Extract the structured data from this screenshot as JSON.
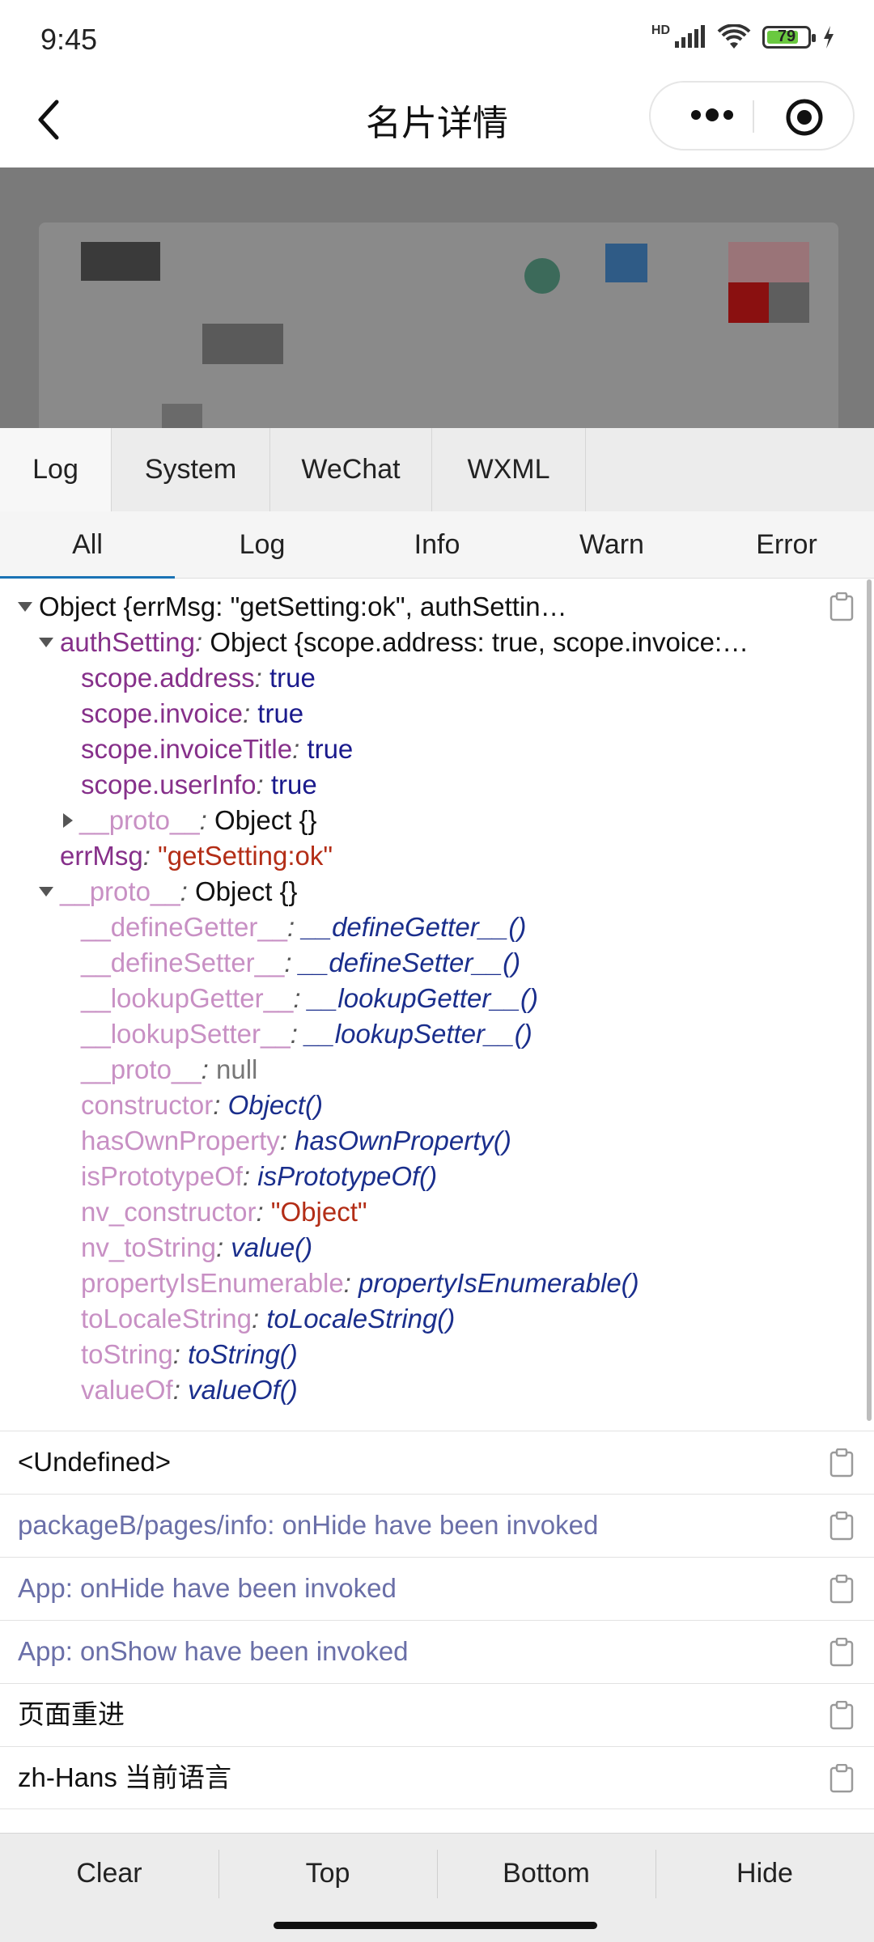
{
  "status_bar": {
    "time": "9:45",
    "battery": "79",
    "network": "HD"
  },
  "nav": {
    "title": "名片详情",
    "back_icon": "chevron-left-icon",
    "more_icon": "more-dots-icon",
    "record_icon": "record-icon"
  },
  "tabs": [
    "Log",
    "System",
    "WeChat",
    "WXML"
  ],
  "subtabs": [
    "All",
    "Log",
    "Info",
    "Warn",
    "Error"
  ],
  "tree": {
    "root": "Object {errMsg: \"getSetting:ok\", authSettin…",
    "auth_key": "authSetting",
    "auth_val": "Object {scope.address: true, scope.invoice:…",
    "auth_items": [
      {
        "key": "scope.address",
        "val": "true"
      },
      {
        "key": "scope.invoice",
        "val": "true"
      },
      {
        "key": "scope.invoiceTitle",
        "val": "true"
      },
      {
        "key": "scope.userInfo",
        "val": "true"
      }
    ],
    "auth_proto_key": "__proto__",
    "auth_proto_val": "Object {}",
    "errmsg_key": "errMsg",
    "errmsg_val": "\"getSetting:ok\"",
    "proto_key": "__proto__",
    "proto_val": "Object {}",
    "proto_items": [
      {
        "key": "__defineGetter__",
        "val": "__defineGetter__()"
      },
      {
        "key": "__defineSetter__",
        "val": "__defineSetter__()"
      },
      {
        "key": "__lookupGetter__",
        "val": "__lookupGetter__()"
      },
      {
        "key": "__lookupSetter__",
        "val": "__lookupSetter__()"
      },
      {
        "key": "__proto__",
        "val": "null"
      },
      {
        "key": "constructor",
        "val": "Object()"
      },
      {
        "key": "hasOwnProperty",
        "val": "hasOwnProperty()"
      },
      {
        "key": "isPrototypeOf",
        "val": "isPrototypeOf()"
      },
      {
        "key": "nv_constructor",
        "val": "\"Object\""
      },
      {
        "key": "nv_toString",
        "val": "value()"
      },
      {
        "key": "propertyIsEnumerable",
        "val": "propertyIsEnumerable()"
      },
      {
        "key": "toLocaleString",
        "val": "toLocaleString()"
      },
      {
        "key": "toString",
        "val": "toString()"
      },
      {
        "key": "valueOf",
        "val": "valueOf()"
      }
    ]
  },
  "logs": [
    "<Undefined>",
    "packageB/pages/info: onHide have been invoked",
    "App: onHide have been invoked",
    "App: onShow have been invoked",
    "页面重进",
    "zh-Hans 当前语言"
  ],
  "toolbar": [
    "Clear",
    "Top",
    "Bottom",
    "Hide"
  ],
  "colors": {
    "key": "#86308a",
    "key_dim": "#c890c4",
    "number": "#1a1a8c",
    "string": "#b32d16",
    "info_log": "#6a6fa8",
    "accent": "#1a73b5"
  }
}
